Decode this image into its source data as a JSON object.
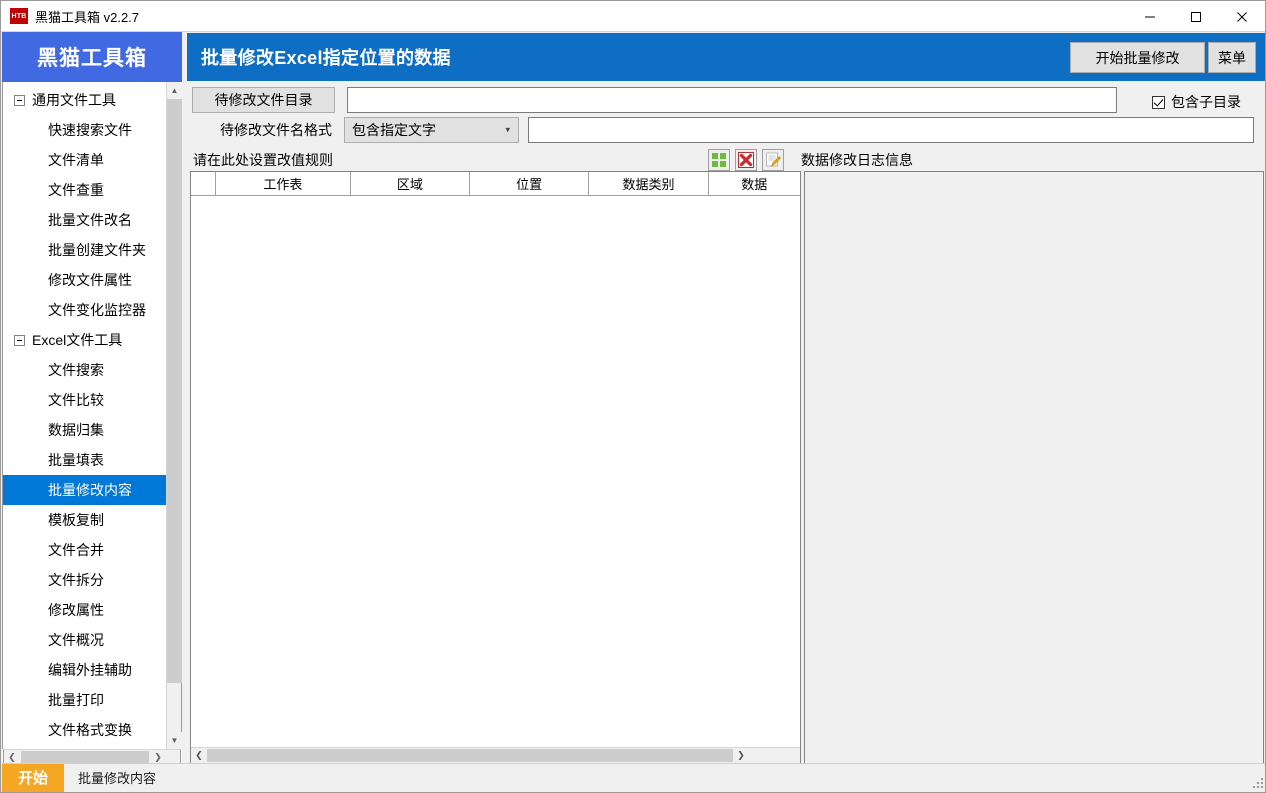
{
  "window": {
    "app_icon_text": "HTB",
    "title": "黑猫工具箱 v2.2.7",
    "minimize_label": "最小化",
    "maximize_label": "最大化",
    "close_label": "关闭"
  },
  "sidebar": {
    "brand": "黑猫工具箱",
    "groups": [
      {
        "label": "通用文件工具",
        "items": [
          "快速搜索文件",
          "文件清单",
          "文件查重",
          "批量文件改名",
          "批量创建文件夹",
          "修改文件属性",
          "文件变化监控器"
        ]
      },
      {
        "label": "Excel文件工具",
        "items": [
          "文件搜索",
          "文件比较",
          "数据归集",
          "批量填表",
          "批量修改内容",
          "模板复制",
          "文件合并",
          "文件拆分",
          "修改属性",
          "文件概况",
          "编辑外挂辅助",
          "批量打印",
          "文件格式变换"
        ]
      }
    ],
    "selected_item": "批量修改内容"
  },
  "header": {
    "title": "批量修改Excel指定位置的数据",
    "start_button": "开始批量修改",
    "menu_button": "菜单"
  },
  "form": {
    "dir_button": "待修改文件目录",
    "dir_value": "",
    "dir_placeholder": "",
    "include_subdir_label": "包含子目录",
    "include_subdir_checked": true,
    "name_format_label": "待修改文件名格式",
    "name_format_selected": "包含指定文字",
    "name_format_options": [
      "包含指定文字"
    ],
    "name_format_value": "",
    "name_format_placeholder": ""
  },
  "strip": {
    "rule_hint": "请在此处设置改值规则",
    "log_title": "数据修改日志信息",
    "icons": [
      {
        "name": "add-grid-icon",
        "tip": "新增规则"
      },
      {
        "name": "delete-x-icon",
        "tip": "删除规则"
      },
      {
        "name": "edit-note-icon",
        "tip": "编辑规则"
      }
    ]
  },
  "grid": {
    "columns": [
      "",
      "工作表",
      "区域",
      "位置",
      "数据类别",
      "数据"
    ],
    "rows": []
  },
  "log": {
    "content": ""
  },
  "statusbar": {
    "tab_label": "开始",
    "current_tool": "批量修改内容"
  },
  "colors": {
    "sidebar_brand_bg": "#4169E1",
    "header_bg": "#0D6EC4",
    "selected_item_bg": "#0078D7",
    "status_tab_bg": "#F5A623",
    "app_icon_bg": "#C00000"
  }
}
